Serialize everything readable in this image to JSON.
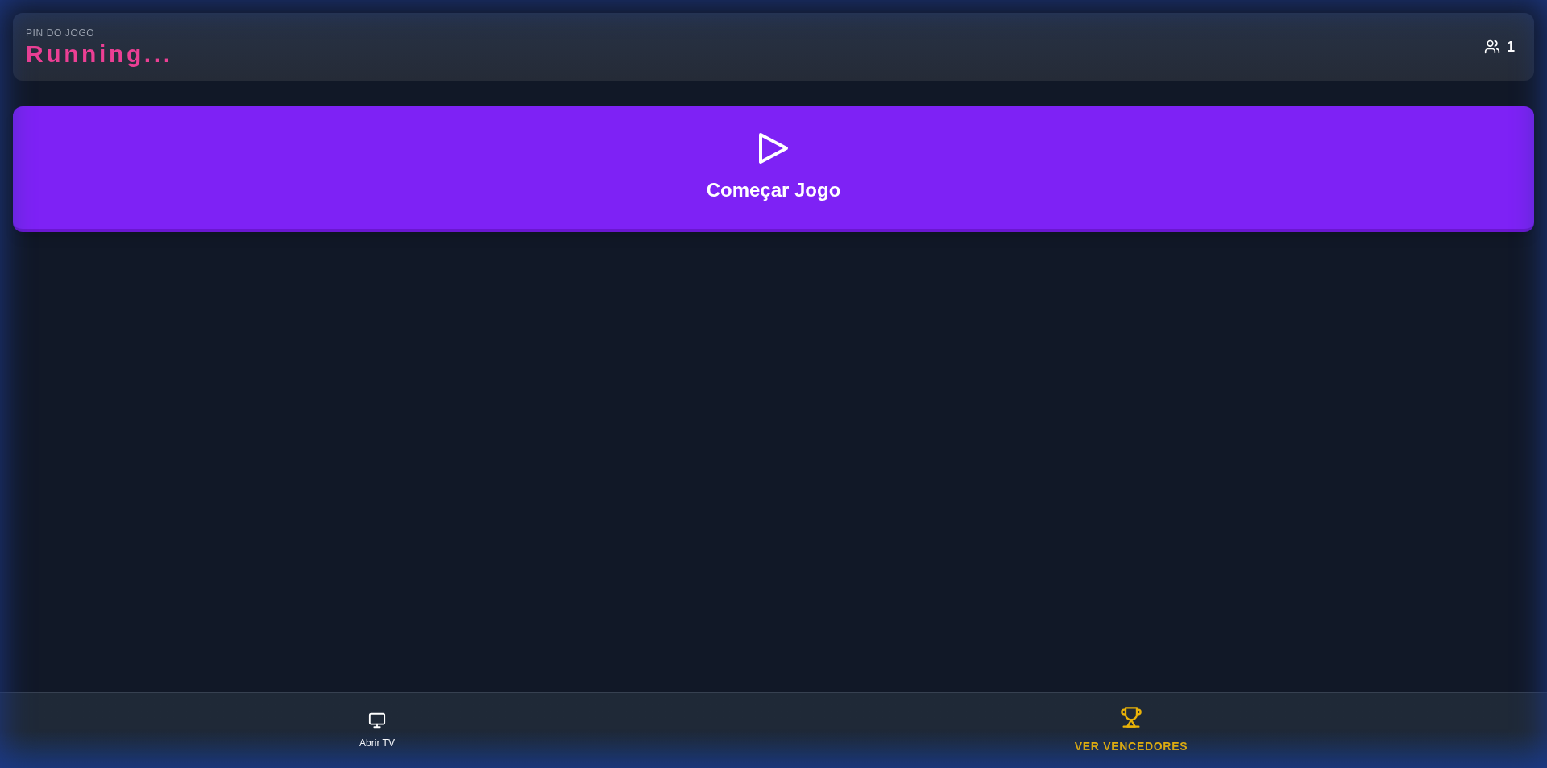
{
  "header": {
    "label": "PIN DO JOGO",
    "pin": "Running...",
    "player_count": "1"
  },
  "start_button": {
    "label": "Começar Jogo"
  },
  "bottom_nav": [
    {
      "label": "Abrir TV",
      "selected": false
    },
    {
      "label": "VER VENCEDORES",
      "selected": true
    }
  ]
}
